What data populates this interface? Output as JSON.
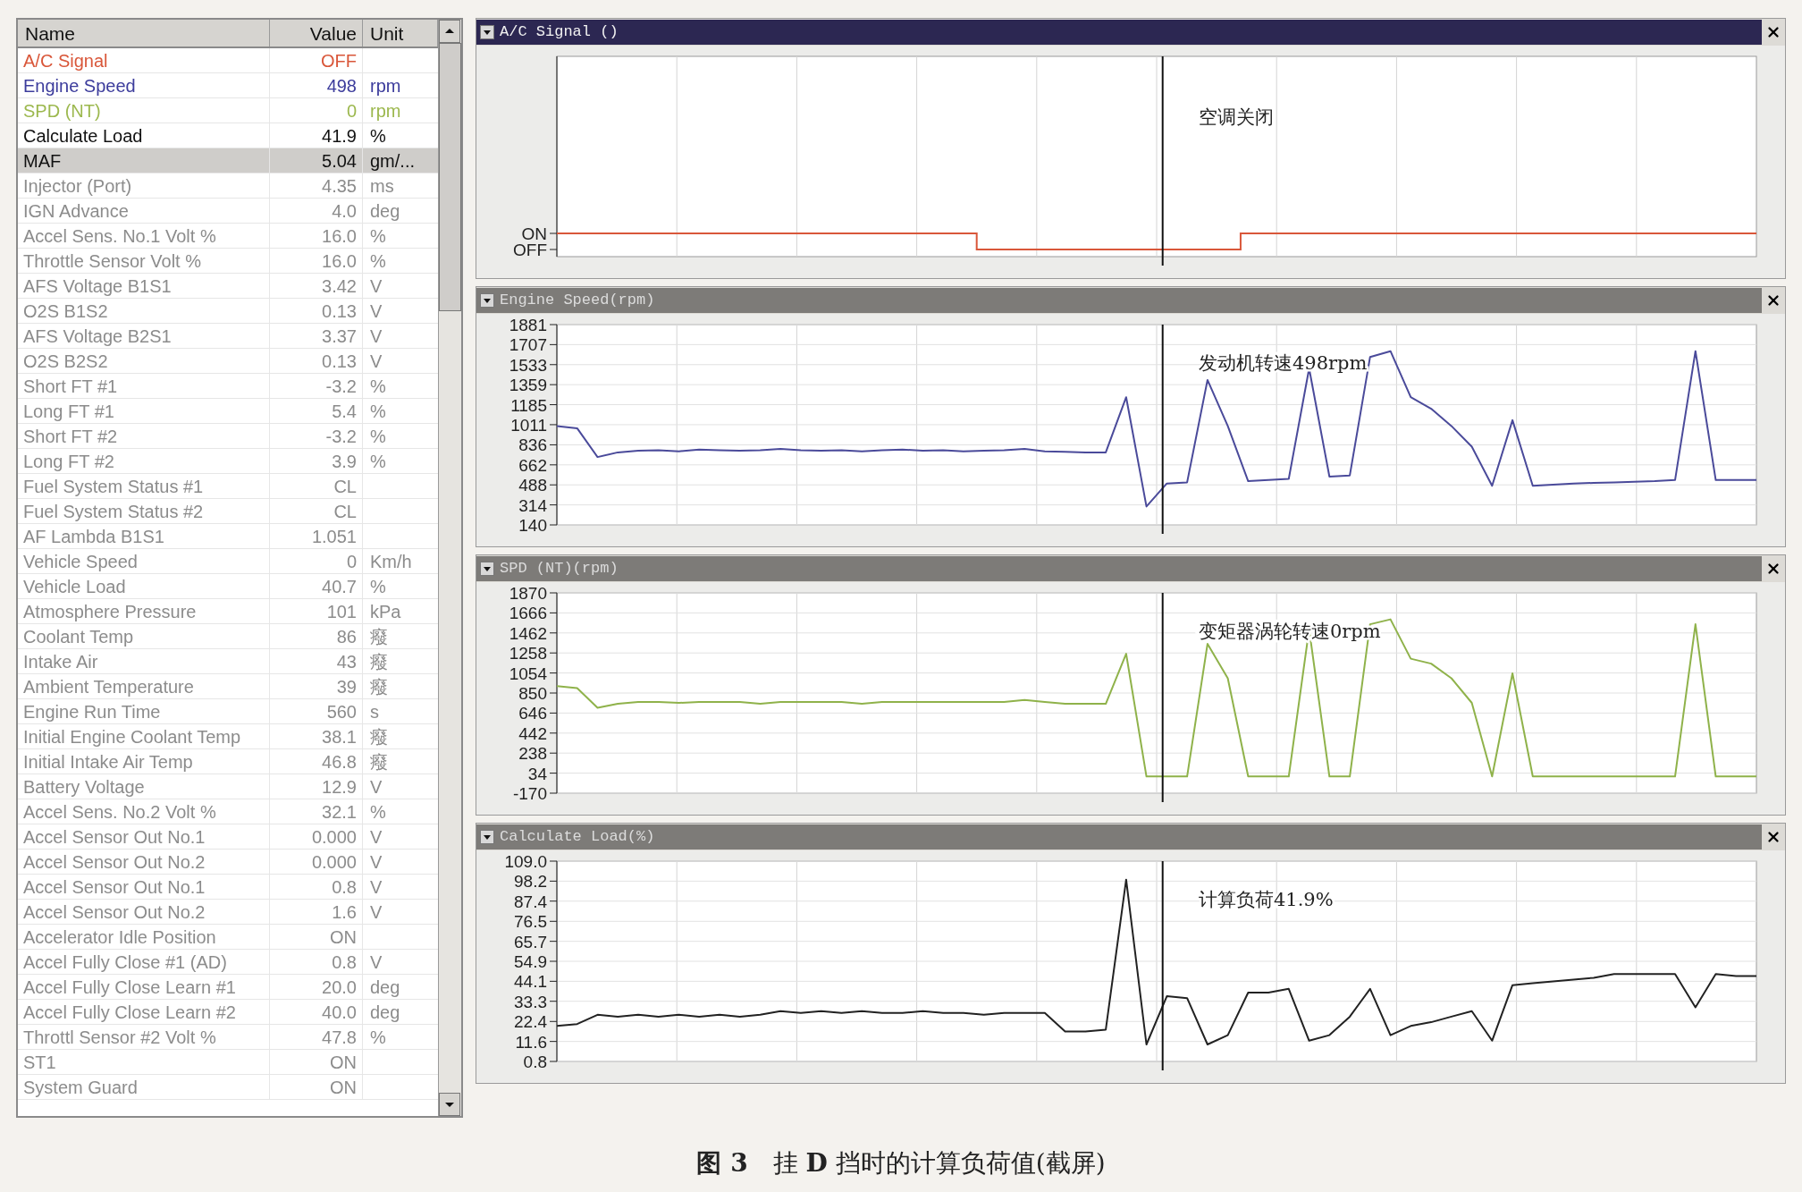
{
  "table": {
    "columns": [
      "Name",
      "Value",
      "Unit"
    ],
    "rows": [
      {
        "name": "A/C Signal",
        "value": "OFF",
        "unit": "",
        "color": "#d9573a",
        "selected": false
      },
      {
        "name": "Engine Speed",
        "value": "498",
        "unit": "rpm",
        "color": "#3c3c9c",
        "selected": false
      },
      {
        "name": "SPD (NT)",
        "value": "0",
        "unit": "rpm",
        "color": "#9cb84e",
        "selected": false
      },
      {
        "name": "Calculate Load",
        "value": "41.9",
        "unit": "%",
        "color": "#111111",
        "selected": false
      },
      {
        "name": "MAF",
        "value": "5.04",
        "unit": "gm/...",
        "color": "#111111",
        "selected": true
      },
      {
        "name": "Injector (Port)",
        "value": "4.35",
        "unit": "ms",
        "color": "#8c8c8c",
        "selected": false
      },
      {
        "name": "IGN Advance",
        "value": "4.0",
        "unit": "deg",
        "color": "#8c8c8c",
        "selected": false
      },
      {
        "name": "Accel Sens. No.1 Volt %",
        "value": "16.0",
        "unit": "%",
        "color": "#8c8c8c",
        "selected": false
      },
      {
        "name": "Throttle Sensor Volt %",
        "value": "16.0",
        "unit": "%",
        "color": "#8c8c8c",
        "selected": false
      },
      {
        "name": "AFS Voltage B1S1",
        "value": "3.42",
        "unit": "V",
        "color": "#8c8c8c",
        "selected": false
      },
      {
        "name": "O2S B1S2",
        "value": "0.13",
        "unit": "V",
        "color": "#8c8c8c",
        "selected": false
      },
      {
        "name": "AFS Voltage B2S1",
        "value": "3.37",
        "unit": "V",
        "color": "#8c8c8c",
        "selected": false
      },
      {
        "name": "O2S B2S2",
        "value": "0.13",
        "unit": "V",
        "color": "#8c8c8c",
        "selected": false
      },
      {
        "name": "Short FT #1",
        "value": "-3.2",
        "unit": "%",
        "color": "#8c8c8c",
        "selected": false
      },
      {
        "name": "Long FT #1",
        "value": "5.4",
        "unit": "%",
        "color": "#8c8c8c",
        "selected": false
      },
      {
        "name": "Short FT #2",
        "value": "-3.2",
        "unit": "%",
        "color": "#8c8c8c",
        "selected": false
      },
      {
        "name": "Long FT #2",
        "value": "3.9",
        "unit": "%",
        "color": "#8c8c8c",
        "selected": false
      },
      {
        "name": "Fuel System Status #1",
        "value": "CL",
        "unit": "",
        "color": "#8c8c8c",
        "selected": false
      },
      {
        "name": "Fuel System Status #2",
        "value": "CL",
        "unit": "",
        "color": "#8c8c8c",
        "selected": false
      },
      {
        "name": "AF Lambda B1S1",
        "value": "1.051",
        "unit": "",
        "color": "#8c8c8c",
        "selected": false
      },
      {
        "name": "Vehicle Speed",
        "value": "0",
        "unit": "Km/h",
        "color": "#8c8c8c",
        "selected": false
      },
      {
        "name": "Vehicle Load",
        "value": "40.7",
        "unit": "%",
        "color": "#8c8c8c",
        "selected": false
      },
      {
        "name": "Atmosphere Pressure",
        "value": "101",
        "unit": "kPa",
        "color": "#8c8c8c",
        "selected": false
      },
      {
        "name": "Coolant Temp",
        "value": "86",
        "unit": "癈",
        "color": "#8c8c8c",
        "selected": false
      },
      {
        "name": "Intake Air",
        "value": "43",
        "unit": "癈",
        "color": "#8c8c8c",
        "selected": false
      },
      {
        "name": "Ambient Temperature",
        "value": "39",
        "unit": "癈",
        "color": "#8c8c8c",
        "selected": false
      },
      {
        "name": "Engine Run Time",
        "value": "560",
        "unit": "s",
        "color": "#8c8c8c",
        "selected": false
      },
      {
        "name": "Initial Engine Coolant Temp",
        "value": "38.1",
        "unit": "癈",
        "color": "#8c8c8c",
        "selected": false
      },
      {
        "name": "Initial Intake Air Temp",
        "value": "46.8",
        "unit": "癈",
        "color": "#8c8c8c",
        "selected": false
      },
      {
        "name": "Battery Voltage",
        "value": "12.9",
        "unit": "V",
        "color": "#8c8c8c",
        "selected": false
      },
      {
        "name": "Accel Sens. No.2 Volt %",
        "value": "32.1",
        "unit": "%",
        "color": "#8c8c8c",
        "selected": false
      },
      {
        "name": "Accel Sensor Out No.1",
        "value": "0.000",
        "unit": "V",
        "color": "#8c8c8c",
        "selected": false
      },
      {
        "name": "Accel Sensor Out No.2",
        "value": "0.000",
        "unit": "V",
        "color": "#8c8c8c",
        "selected": false
      },
      {
        "name": "Accel Sensor Out No.1",
        "value": "0.8",
        "unit": "V",
        "color": "#8c8c8c",
        "selected": false
      },
      {
        "name": "Accel Sensor Out No.2",
        "value": "1.6",
        "unit": "V",
        "color": "#8c8c8c",
        "selected": false
      },
      {
        "name": "Accelerator Idle Position",
        "value": "ON",
        "unit": "",
        "color": "#8c8c8c",
        "selected": false
      },
      {
        "name": "Accel Fully Close #1 (AD)",
        "value": "0.8",
        "unit": "V",
        "color": "#8c8c8c",
        "selected": false
      },
      {
        "name": "Accel Fully Close Learn #1",
        "value": "20.0",
        "unit": "deg",
        "color": "#8c8c8c",
        "selected": false
      },
      {
        "name": "Accel Fully Close Learn #2",
        "value": "40.0",
        "unit": "deg",
        "color": "#8c8c8c",
        "selected": false
      },
      {
        "name": "Throttl Sensor #2 Volt %",
        "value": "47.8",
        "unit": "%",
        "color": "#8c8c8c",
        "selected": false
      },
      {
        "name": "ST1",
        "value": "ON",
        "unit": "",
        "color": "#8c8c8c",
        "selected": false
      },
      {
        "name": "System Guard",
        "value": "ON",
        "unit": "",
        "color": "#8c8c8c",
        "selected": false
      }
    ]
  },
  "graphs": [
    {
      "kind": "on_off",
      "title": "A/C Signal ()",
      "selected": true,
      "axis_labels": [
        "ON",
        "OFF"
      ],
      "color": "#d9573a",
      "annotation": "空调关闭"
    },
    {
      "kind": "line_chart",
      "title": "Engine Speed(rpm)",
      "selected": false,
      "chart_data": {
        "type": "line",
        "categories": [
          null,
          null,
          null,
          null,
          null,
          null,
          null,
          null,
          null,
          null,
          null,
          null,
          null,
          null,
          null,
          null,
          null,
          null,
          null,
          null,
          null,
          null,
          null,
          null,
          null,
          null,
          null,
          null,
          null,
          null,
          null,
          null,
          null,
          null,
          null,
          null,
          null,
          null,
          null,
          null,
          null,
          null,
          null,
          null,
          null,
          null,
          null,
          null,
          null,
          null,
          null,
          null,
          null,
          null,
          null,
          null,
          null,
          null,
          null,
          null
        ],
        "grid": true,
        "ylim": [
          140,
          1881
        ],
        "yticks": [
          140,
          314,
          488,
          662,
          836,
          1011,
          1185,
          1359,
          1533,
          1707,
          1881
        ],
        "series": [
          {
            "color": "#4a4a9a",
            "values": [
              1000,
              980,
              730,
              770,
              785,
              790,
              780,
              795,
              790,
              785,
              790,
              800,
              790,
              785,
              790,
              780,
              790,
              795,
              785,
              790,
              780,
              785,
              790,
              800,
              780,
              775,
              770,
              770,
              1250,
              300,
              500,
              510,
              1400,
              1000,
              520,
              530,
              540,
              1500,
              560,
              570,
              1600,
              1650,
              1250,
              1150,
              1000,
              820,
              480,
              1050,
              480,
              490,
              500,
              505,
              510,
              515,
              520,
              530,
              1650,
              530,
              530,
              530
            ]
          }
        ],
        "annotations": [
          {
            "text": "发动机转速498rpm"
          }
        ]
      }
    },
    {
      "kind": "line_chart",
      "title": "SPD (NT)(rpm)",
      "selected": false,
      "chart_data": {
        "type": "line",
        "categories": [
          null,
          null,
          null,
          null,
          null,
          null,
          null,
          null,
          null,
          null,
          null,
          null,
          null,
          null,
          null,
          null,
          null,
          null,
          null,
          null,
          null,
          null,
          null,
          null,
          null,
          null,
          null,
          null,
          null,
          null,
          null,
          null,
          null,
          null,
          null,
          null,
          null,
          null,
          null,
          null,
          null,
          null,
          null,
          null,
          null,
          null,
          null,
          null,
          null,
          null,
          null,
          null,
          null,
          null,
          null,
          null,
          null,
          null,
          null,
          null
        ],
        "grid": true,
        "ylim": [
          -170,
          1870
        ],
        "yticks": [
          -170,
          34,
          238,
          442,
          646,
          850,
          1054,
          1258,
          1462,
          1666,
          1870
        ],
        "series": [
          {
            "color": "#8fb24a",
            "values": [
              920,
              900,
              700,
              740,
              760,
              760,
              750,
              760,
              760,
              760,
              740,
              760,
              760,
              760,
              760,
              740,
              760,
              760,
              760,
              760,
              760,
              760,
              760,
              780,
              760,
              740,
              740,
              740,
              1250,
              0,
              0,
              0,
              1350,
              1000,
              0,
              0,
              0,
              1500,
              0,
              0,
              1550,
              1600,
              1200,
              1150,
              1000,
              750,
              0,
              1050,
              0,
              0,
              0,
              0,
              0,
              0,
              0,
              0,
              1550,
              0,
              0,
              0
            ]
          }
        ],
        "annotations": [
          {
            "text": "变矩器涡轮转速0rpm"
          }
        ]
      }
    },
    {
      "kind": "line_chart",
      "title": "Calculate Load(%)",
      "selected": false,
      "chart_data": {
        "type": "line",
        "categories": [
          null,
          null,
          null,
          null,
          null,
          null,
          null,
          null,
          null,
          null,
          null,
          null,
          null,
          null,
          null,
          null,
          null,
          null,
          null,
          null,
          null,
          null,
          null,
          null,
          null,
          null,
          null,
          null,
          null,
          null,
          null,
          null,
          null,
          null,
          null,
          null,
          null,
          null,
          null,
          null,
          null,
          null,
          null,
          null,
          null,
          null,
          null,
          null,
          null,
          null,
          null,
          null,
          null,
          null,
          null,
          null,
          null,
          null,
          null,
          null
        ],
        "grid": true,
        "ylim": [
          0.8,
          109
        ],
        "yticks": [
          0.8,
          11.6,
          22.4,
          33.3,
          44.1,
          54.9,
          65.7,
          76.5,
          87.4,
          98.2,
          {
            "value": 109,
            "label": "109.0"
          }
        ],
        "series": [
          {
            "color": "#222222",
            "values": [
              20,
              21,
              26,
              25,
              26,
              25,
              26,
              25,
              26,
              25,
              26,
              28,
              27,
              28,
              27,
              28,
              27,
              27,
              28,
              27,
              27,
              26,
              27,
              27,
              27,
              17,
              17,
              18,
              99,
              10,
              36,
              35,
              10,
              15,
              38,
              38,
              40,
              12,
              15,
              25,
              40,
              15,
              20,
              22,
              25,
              28,
              12,
              42,
              43,
              44,
              45,
              46,
              48,
              48,
              48,
              48,
              30,
              48,
              47,
              47
            ]
          }
        ],
        "annotations": [
          {
            "text": "计算负荷41.9%"
          }
        ]
      }
    }
  ],
  "caption": "**图 3**　挂 **D** 挡时的计算负荷值(截屏)"
}
